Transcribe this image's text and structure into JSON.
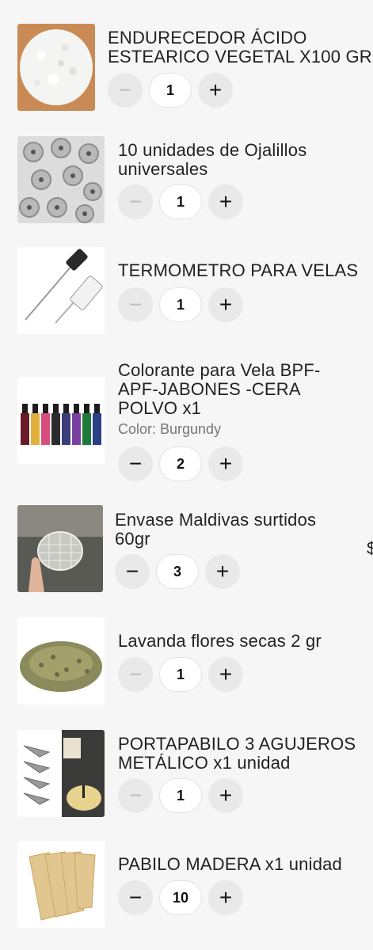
{
  "cart": {
    "items": [
      {
        "title": "ENDURECEDOR ÁCIDO\nESTEARICO VEGETAL X100 GR",
        "variant": "",
        "quantity": "1",
        "minus_label": "−",
        "plus_label": "+",
        "image_icon": "stearic-acid-flakes"
      },
      {
        "title": "10 unidades de Ojalillos\nuniversales",
        "variant": "",
        "quantity": "1",
        "minus_label": "−",
        "plus_label": "+",
        "image_icon": "wick-sustainers"
      },
      {
        "title": "TERMOMETRO PARA VELAS",
        "variant": "",
        "quantity": "1",
        "minus_label": "−",
        "plus_label": "+",
        "image_icon": "digital-thermometer"
      },
      {
        "title": "Colorante para Vela BPF-\nAPF-JABONES -CERA\nPOLVO x1",
        "variant": "Color: Burgundy",
        "quantity": "2",
        "minus_label": "−",
        "plus_label": "+",
        "image_icon": "dye-bottles"
      },
      {
        "title": "Envase Maldivas surtidos\n60gr",
        "variant": "",
        "quantity": "3",
        "minus_label": "−",
        "plus_label": "+",
        "image_icon": "glass-jar"
      },
      {
        "title": "Lavanda flores secas 2 gr",
        "variant": "",
        "quantity": "1",
        "minus_label": "−",
        "plus_label": "+",
        "image_icon": "dried-lavender"
      },
      {
        "title": "PORTAPABILO 3 AGUJEROS\nMETÁLICO x1 unidad",
        "variant": "",
        "quantity": "1",
        "minus_label": "−",
        "plus_label": "+",
        "image_icon": "metal-wick-holder"
      },
      {
        "title": "PABILO MADERA x1 unidad",
        "variant": "",
        "quantity": "10",
        "minus_label": "−",
        "plus_label": "+",
        "image_icon": "wooden-wicks"
      }
    ],
    "edge_glyph": "$"
  }
}
